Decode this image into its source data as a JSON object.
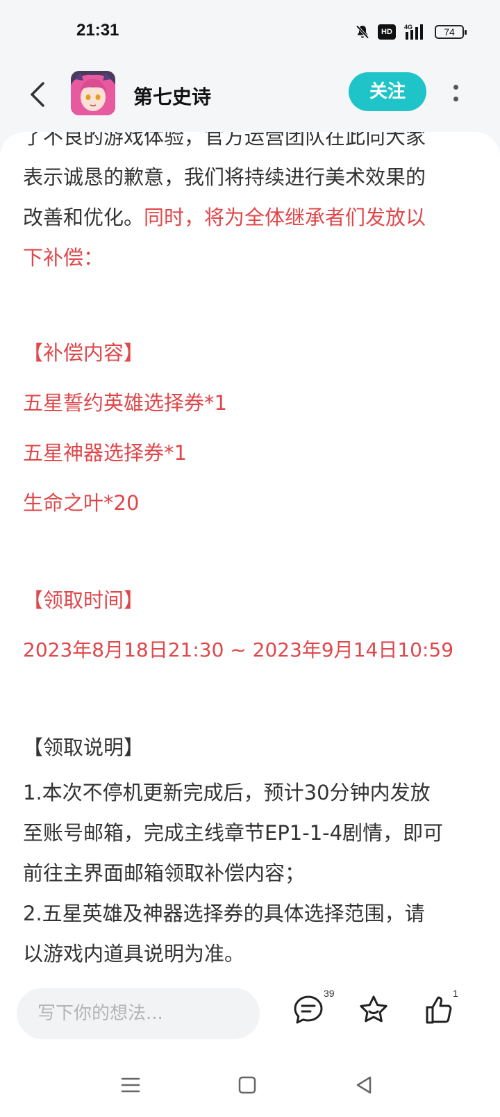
{
  "status_bar": {
    "time": "21:31",
    "network": "4G",
    "hd": "HD",
    "battery": "74",
    "icons": [
      "mute-bell-icon",
      "hd-icon",
      "signal-icon",
      "battery-icon"
    ]
  },
  "header": {
    "title": "第七史诗",
    "follow_label": "关注",
    "icons": [
      "back-arrow-icon",
      "avatar",
      "more-vertical-icon"
    ],
    "accent_color": "#1ec4c8"
  },
  "article": {
    "intro_lines": [
      "了不良的游戏体验，官方运营团队在此向大家",
      "表示诚恳的歉意，我们将持续进行美术效果的"
    ],
    "line3_normal": "改善和优化。",
    "line3_red": "同时，将为全体继承者们发放以",
    "line4_red": "下补偿：",
    "compensation_heading": "【补偿内容】",
    "compensation_items": [
      "五星誓约英雄选择券*1",
      "五星神器选择券*1",
      "生命之叶*20"
    ],
    "time_heading": "【领取时间】",
    "time_range": "2023年8月18日21:30 ~ 2023年9月14日10:59",
    "instructions_heading": "【领取说明】",
    "instruction_lines": [
      "1.本次不停机更新完成后，预计30分钟内发放",
      "至账号邮箱，完成主线章节EP1-1-4剧情，即可",
      "前往主界面邮箱领取补偿内容；",
      "2.五星英雄及神器选择券的具体选择范围，请",
      "以游戏内道具说明为准。"
    ],
    "highlight_color": "#e0474a"
  },
  "bottom_bar": {
    "comment_placeholder": "写下你的想法...",
    "comment_count": "39",
    "like_count": "1",
    "icons": [
      "comment-icon",
      "star-icon",
      "thumbs-up-icon"
    ]
  },
  "nav_bar": {
    "icons": [
      "menu-icon",
      "home-square-icon",
      "back-triangle-icon"
    ]
  }
}
